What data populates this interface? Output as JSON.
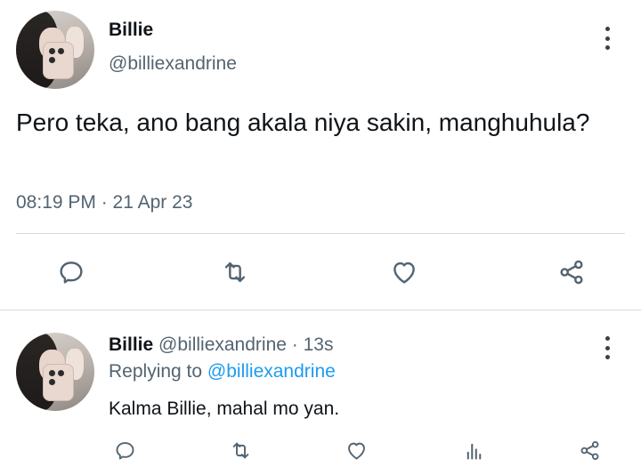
{
  "main_tweet": {
    "author_name": "Billie",
    "author_handle": "@billiexandrine",
    "text": "Pero teka, ano bang akala niya sakin, manghuhula?",
    "timestamp": "08:19 PM · 21 Apr 23"
  },
  "reply_tweet": {
    "author_name": "Billie",
    "author_handle": "@billiexandrine",
    "separator": "·",
    "time_ago": "13s",
    "replying_prefix": "Replying to",
    "replying_handle": "@billiexandrine",
    "text": "Kalma Billie, mahal mo yan."
  },
  "icons": {
    "reply": "reply-icon",
    "retweet": "retweet-icon",
    "like": "heart-icon",
    "views": "views-icon",
    "share": "share-icon",
    "more": "more-vertical-icon"
  },
  "colors": {
    "text": "#0f1419",
    "muted": "#536471",
    "link": "#1d9bf0",
    "divider": "#d6dbdf",
    "icon": "#536471"
  }
}
